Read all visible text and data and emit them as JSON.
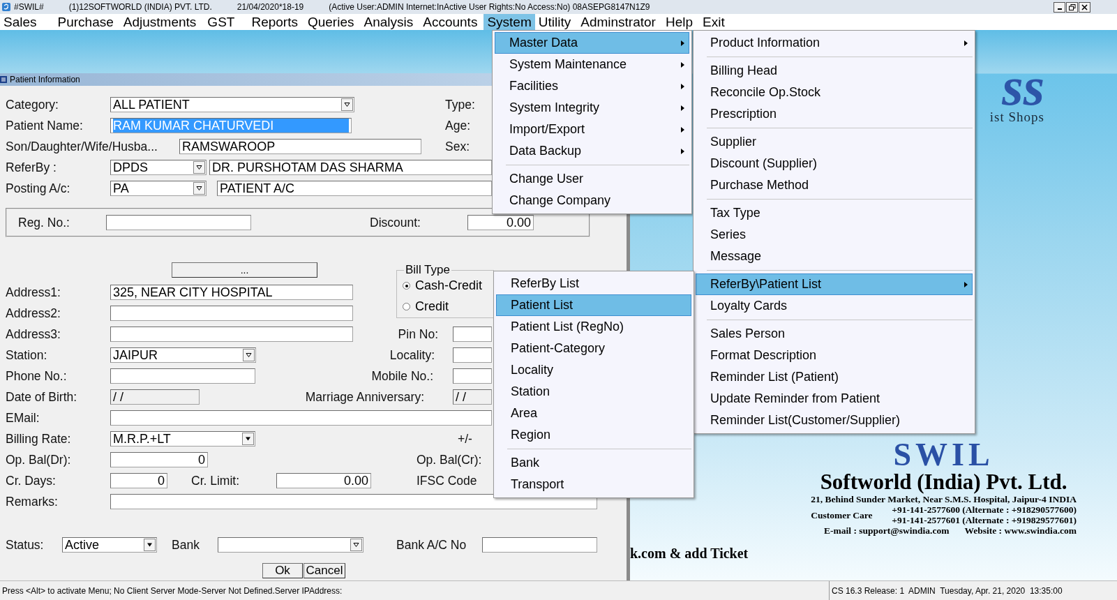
{
  "window": {
    "app": "#SWIL#",
    "company": "(1)12SOFTWORLD (INDIA) PVT. LTD.",
    "period": "21/04/2020*18-19",
    "session": "(Active User:ADMIN Internet:InActive User Rights:No Access:No) 08ASEPG8147N1Z9"
  },
  "menubar": [
    {
      "label": "Sales",
      "selected": false
    },
    {
      "label": "Purchase",
      "selected": false
    },
    {
      "label": "Adjustments",
      "selected": false
    },
    {
      "label": "GST",
      "selected": false
    },
    {
      "label": "Reports",
      "selected": false
    },
    {
      "label": "Queries",
      "selected": false
    },
    {
      "label": "Analysis",
      "selected": false
    },
    {
      "label": "Accounts",
      "selected": false
    },
    {
      "label": "System",
      "selected": true
    },
    {
      "label": "Utility",
      "selected": false
    },
    {
      "label": "Adminstrator",
      "selected": false
    },
    {
      "label": "Help",
      "selected": false
    },
    {
      "label": "Exit",
      "selected": false
    }
  ],
  "form": {
    "title": "Patient Information",
    "category": {
      "label": "Category:",
      "value": "ALL PATIENT"
    },
    "patient_name": {
      "label": "Patient Name:",
      "value": "RAM KUMAR CHATURVEDI",
      "selected": true
    },
    "relation_name": {
      "label": "Son/Daughter/Wife/Husba...",
      "value": "RAMSWAROOP"
    },
    "refer_by": {
      "label": "ReferBy :",
      "code": "DPDS",
      "name": "DR. PURSHOTAM DAS SHARMA"
    },
    "posting_ac": {
      "label": "Posting A/c:",
      "code": "PA",
      "name": "PATIENT A/C"
    },
    "type": {
      "label": "Type:"
    },
    "age": {
      "label": "Age:"
    },
    "sex": {
      "label": "Sex:"
    },
    "reg_no": {
      "label": "Reg. No.:"
    },
    "discount": {
      "label": "Discount:",
      "value": "0.00"
    },
    "more_button": "...",
    "bill_type": {
      "label": "Bill Type",
      "options": [
        {
          "label": "Cash-Credit",
          "selected": true
        },
        {
          "label": "Credit",
          "selected": false
        }
      ]
    },
    "address1": {
      "label": "Address1:",
      "value": "325, NEAR CITY HOSPITAL"
    },
    "address2": {
      "label": "Address2:"
    },
    "address3": {
      "label": "Address3:"
    },
    "pin_no": {
      "label": "Pin No:"
    },
    "station": {
      "label": "Station:",
      "value": "JAIPUR"
    },
    "locality": {
      "label": "Locality:"
    },
    "phone_no": {
      "label": "Phone No.:"
    },
    "mobile_no": {
      "label": "Mobile No.:"
    },
    "date_of_birth": {
      "label": "Date of Birth:",
      "value": "/  /"
    },
    "marriage_anniversary": {
      "label": "Marriage Anniversary:",
      "value": "/  /"
    },
    "email": {
      "label": "EMail:"
    },
    "billing_rate": {
      "label": "Billing Rate:",
      "value": "M.R.P.+LT"
    },
    "plus_minus": "+/-",
    "op_bal_dr": {
      "label": "Op. Bal(Dr):",
      "value": "0"
    },
    "op_bal_cr": {
      "label": "Op. Bal(Cr):"
    },
    "cr_days": {
      "label": "Cr. Days:",
      "value": "0"
    },
    "cr_limit": {
      "label": "Cr. Limit:",
      "value": "0.00"
    },
    "ifsc_code": {
      "label": "IFSC Code"
    },
    "remarks": {
      "label": "Remarks:"
    },
    "status": {
      "label": "Status:",
      "value": "Active"
    },
    "bank": {
      "label": "Bank"
    },
    "bank_ac_no": {
      "label": "Bank A/C No"
    },
    "buttons": [
      "Ok",
      "Cancel"
    ]
  },
  "menus": [
    {
      "items": [
        {
          "kind": "item",
          "label": "Master Data",
          "submenu": true,
          "selected": true
        },
        {
          "kind": "item",
          "label": "System Maintenance",
          "submenu": true,
          "selected": false
        },
        {
          "kind": "item",
          "label": "Facilities",
          "submenu": true,
          "selected": false
        },
        {
          "kind": "item",
          "label": "System Integrity",
          "submenu": true,
          "selected": false
        },
        {
          "kind": "item",
          "label": "Import/Export",
          "submenu": true,
          "selected": false
        },
        {
          "kind": "item",
          "label": "Data Backup",
          "submenu": true,
          "selected": false
        },
        {
          "kind": "separator"
        },
        {
          "kind": "item",
          "label": "Change User",
          "submenu": false,
          "selected": false
        },
        {
          "kind": "item",
          "label": "Change Company",
          "submenu": false,
          "selected": false
        }
      ]
    },
    {
      "items": [
        {
          "kind": "item",
          "label": "Product Information",
          "submenu": true,
          "selected": false
        },
        {
          "kind": "separator"
        },
        {
          "kind": "item",
          "label": "Billing Head",
          "submenu": false,
          "selected": false
        },
        {
          "kind": "item",
          "label": "Reconcile Op.Stock",
          "submenu": false,
          "selected": false
        },
        {
          "kind": "item",
          "label": "Prescription",
          "submenu": false,
          "selected": false
        },
        {
          "kind": "separator"
        },
        {
          "kind": "item",
          "label": "Supplier",
          "submenu": false,
          "selected": false
        },
        {
          "kind": "item",
          "label": "Discount (Supplier)",
          "submenu": false,
          "selected": false
        },
        {
          "kind": "item",
          "label": "Purchase Method",
          "submenu": false,
          "selected": false
        },
        {
          "kind": "separator"
        },
        {
          "kind": "item",
          "label": "Tax Type",
          "submenu": false,
          "selected": false
        },
        {
          "kind": "item",
          "label": "Series",
          "submenu": false,
          "selected": false
        },
        {
          "kind": "item",
          "label": "Message",
          "submenu": false,
          "selected": false
        },
        {
          "kind": "separator"
        },
        {
          "kind": "item",
          "label": "ReferBy\\Patient List",
          "submenu": true,
          "selected": true
        },
        {
          "kind": "item",
          "label": "Loyalty Cards",
          "submenu": false,
          "selected": false
        },
        {
          "kind": "separator"
        },
        {
          "kind": "item",
          "label": "Sales Person",
          "submenu": false,
          "selected": false
        },
        {
          "kind": "item",
          "label": "Format Description",
          "submenu": false,
          "selected": false
        },
        {
          "kind": "item",
          "label": "Reminder List (Patient)",
          "submenu": false,
          "selected": false
        },
        {
          "kind": "item",
          "label": "Update Reminder from Patient",
          "submenu": false,
          "selected": false
        },
        {
          "kind": "item",
          "label": "Reminder List(Customer/Supplier)",
          "submenu": false,
          "selected": false
        }
      ]
    },
    {
      "items": [
        {
          "kind": "item",
          "label": "ReferBy List",
          "submenu": false,
          "selected": false
        },
        {
          "kind": "item",
          "label": "Patient List",
          "submenu": false,
          "selected": true
        },
        {
          "kind": "item",
          "label": "Patient List (RegNo)",
          "submenu": false,
          "selected": false
        },
        {
          "kind": "item",
          "label": "Patient-Category",
          "submenu": false,
          "selected": false
        },
        {
          "kind": "item",
          "label": "Locality",
          "submenu": false,
          "selected": false
        },
        {
          "kind": "item",
          "label": "Station",
          "submenu": false,
          "selected": false
        },
        {
          "kind": "item",
          "label": "Area",
          "submenu": false,
          "selected": false
        },
        {
          "kind": "item",
          "label": "Region",
          "submenu": false,
          "selected": false
        },
        {
          "kind": "separator"
        },
        {
          "kind": "item",
          "label": "Bank",
          "submenu": false,
          "selected": false
        },
        {
          "kind": "item",
          "label": "Transport",
          "submenu": false,
          "selected": false
        }
      ]
    }
  ],
  "background": {
    "logo_fragment": "ss",
    "tagline_fragment": "ist Shops",
    "brand": "SWIL",
    "company": "Softworld (India) Pvt. Ltd.",
    "address": "21, Behind Sunder Market, Near S.M.S. Hospital, Jaipur-4 INDIA",
    "customer_care": "Customer Care",
    "phones": [
      "+91-141-2577600 (Alternate : +918290577600)",
      "+91-141-2577601 (Alternate : +919829577601)"
    ],
    "email": "E-mail : support@swindia.com",
    "website": "Website : www.swindia.com",
    "ticket_fragment": "k.com & add Ticket"
  },
  "status_bar": {
    "message": "Press <Alt> to activate Menu; No Client Server Mode-Server Not Defined.Server IPAddress:",
    "info": "CS 16.3 Release: 1  ADMIN  Tuesday, Apr. 21, 2020  13:35:00"
  }
}
